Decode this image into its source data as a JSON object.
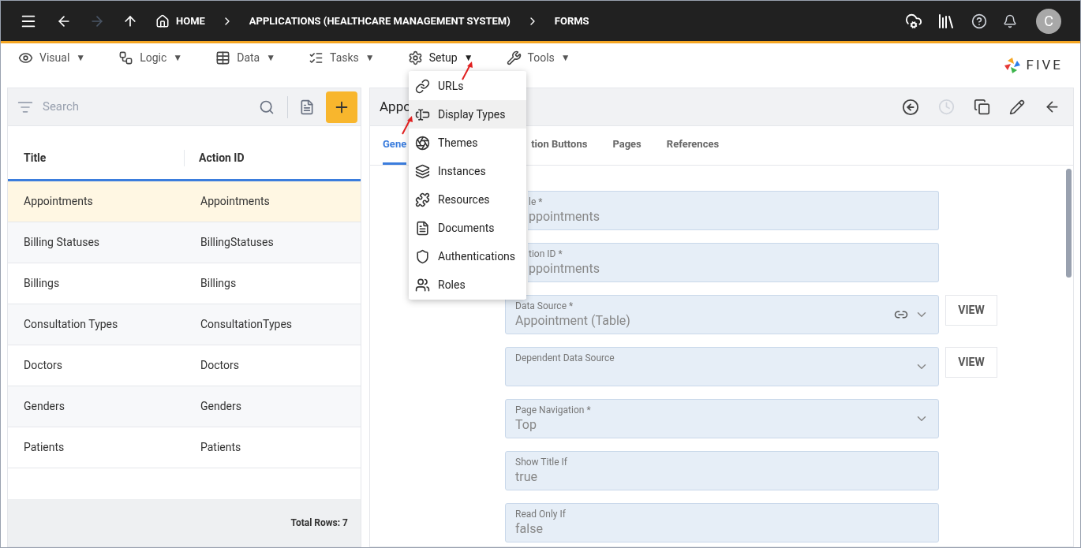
{
  "topbar": {
    "breadcrumbs": [
      "HOME",
      "APPLICATIONS (HEALTHCARE MANAGEMENT SYSTEM)",
      "FORMS"
    ],
    "avatar": "C"
  },
  "menubar": {
    "items": [
      {
        "label": "Visual",
        "caret": "▼",
        "open": false
      },
      {
        "label": "Logic",
        "caret": "▼",
        "open": false
      },
      {
        "label": "Data",
        "caret": "▼",
        "open": false
      },
      {
        "label": "Tasks",
        "caret": "▼",
        "open": false
      },
      {
        "label": "Setup",
        "caret": "▼",
        "open": true
      },
      {
        "label": "Tools",
        "caret": "▼",
        "open": false
      }
    ],
    "logo": "FIVE"
  },
  "setup_menu": [
    {
      "label": "URLs",
      "selected": false
    },
    {
      "label": "Display Types",
      "selected": true
    },
    {
      "label": "Themes",
      "selected": false
    },
    {
      "label": "Instances",
      "selected": false
    },
    {
      "label": "Resources",
      "selected": false
    },
    {
      "label": "Documents",
      "selected": false
    },
    {
      "label": "Authentications",
      "selected": false
    },
    {
      "label": "Roles",
      "selected": false
    }
  ],
  "list": {
    "search_placeholder": "Search",
    "columns": [
      "Title",
      "Action ID"
    ],
    "rows": [
      {
        "title": "Appointments",
        "action_id": "Appointments",
        "selected": true
      },
      {
        "title": "Billing Statuses",
        "action_id": "BillingStatuses",
        "selected": false
      },
      {
        "title": "Billings",
        "action_id": "Billings",
        "selected": false
      },
      {
        "title": "Consultation Types",
        "action_id": "ConsultationTypes",
        "selected": false
      },
      {
        "title": "Doctors",
        "action_id": "Doctors",
        "selected": false
      },
      {
        "title": "Genders",
        "action_id": "Genders",
        "selected": false
      },
      {
        "title": "Patients",
        "action_id": "Patients",
        "selected": false
      }
    ],
    "total": "Total Rows: 7"
  },
  "form": {
    "title": "Appo",
    "tabs": [
      {
        "label": "Gene",
        "selected": true
      },
      {
        "label": "tion Buttons",
        "selected": false,
        "partly_hidden": true
      },
      {
        "label": "Pages",
        "selected": false
      },
      {
        "label": "References",
        "selected": false
      }
    ],
    "fields": [
      {
        "label": "le *",
        "value": "ppointments",
        "kind": "text",
        "partly_hidden": true
      },
      {
        "label": "tion ID *",
        "value": "ppointments",
        "kind": "text",
        "partly_hidden": true
      },
      {
        "label": "Data Source *",
        "value": "Appointment (Table)",
        "kind": "select",
        "link": true,
        "button": "VIEW"
      },
      {
        "label": "Dependent Data Source",
        "kind": "select",
        "button": "VIEW"
      },
      {
        "label": "Page Navigation *",
        "value": "Top",
        "kind": "select"
      },
      {
        "label": "Show Title If",
        "value": "true",
        "kind": "text"
      },
      {
        "label": "Read Only If",
        "value": "false",
        "kind": "text"
      }
    ]
  }
}
